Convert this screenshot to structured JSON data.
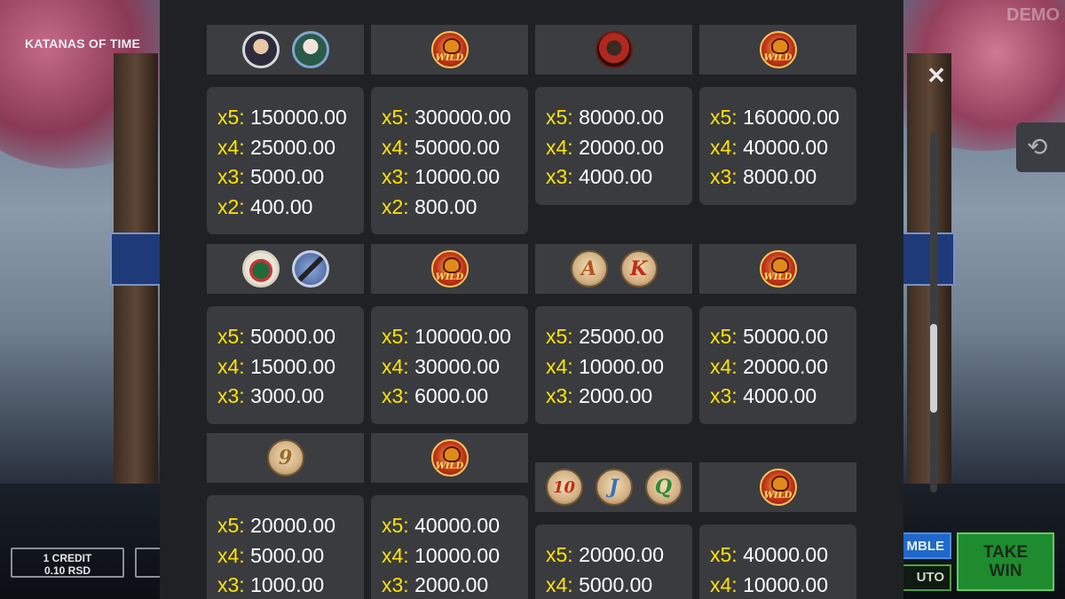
{
  "game": {
    "title": "KATANAS OF TIME",
    "demo_label": "DEMO"
  },
  "bottom_bar": {
    "credit_line1": "1 CREDIT",
    "credit_line2": "0.10 RSD",
    "gamble_label": "MBLE",
    "auto_label": "UTO",
    "take_win_line1": "TAKE",
    "take_win_line2": "WIN"
  },
  "controls": {
    "close_icon": "close-icon",
    "history_icon": "history-icon"
  },
  "paytable": [
    {
      "symbols": [
        "samurai-portrait",
        "geisha-portrait"
      ],
      "pays": [
        [
          "x5:",
          "150000.00"
        ],
        [
          "x4:",
          "25000.00"
        ],
        [
          "x3:",
          "5000.00"
        ],
        [
          "x2:",
          "400.00"
        ]
      ]
    },
    {
      "symbols": [
        "wild"
      ],
      "pays": [
        [
          "x5:",
          "300000.00"
        ],
        [
          "x4:",
          "50000.00"
        ],
        [
          "x3:",
          "10000.00"
        ],
        [
          "x2:",
          "800.00"
        ]
      ]
    },
    {
      "symbols": [
        "samurai-mask"
      ],
      "pays": [
        [
          "x5:",
          "80000.00"
        ],
        [
          "x4:",
          "20000.00"
        ],
        [
          "x3:",
          "4000.00"
        ]
      ]
    },
    {
      "symbols": [
        "wild"
      ],
      "pays": [
        [
          "x5:",
          "160000.00"
        ],
        [
          "x4:",
          "40000.00"
        ],
        [
          "x3:",
          "8000.00"
        ]
      ]
    },
    {
      "symbols": [
        "fan",
        "katana"
      ],
      "pays": [
        [
          "x5:",
          "50000.00"
        ],
        [
          "x4:",
          "15000.00"
        ],
        [
          "x3:",
          "3000.00"
        ]
      ]
    },
    {
      "symbols": [
        "wild"
      ],
      "pays": [
        [
          "x5:",
          "100000.00"
        ],
        [
          "x4:",
          "30000.00"
        ],
        [
          "x3:",
          "6000.00"
        ]
      ]
    },
    {
      "symbols": [
        "A",
        "K"
      ],
      "pays": [
        [
          "x5:",
          "25000.00"
        ],
        [
          "x4:",
          "10000.00"
        ],
        [
          "x3:",
          "2000.00"
        ]
      ]
    },
    {
      "symbols": [
        "wild"
      ],
      "pays": [
        [
          "x5:",
          "50000.00"
        ],
        [
          "x4:",
          "20000.00"
        ],
        [
          "x3:",
          "4000.00"
        ]
      ]
    },
    {
      "symbols": [
        "9"
      ],
      "pays": [
        [
          "x5:",
          "20000.00"
        ],
        [
          "x4:",
          "5000.00"
        ],
        [
          "x3:",
          "1000.00"
        ]
      ]
    },
    {
      "symbols": [
        "wild"
      ],
      "pays": [
        [
          "x5:",
          "40000.00"
        ],
        [
          "x4:",
          "10000.00"
        ],
        [
          "x3:",
          "2000.00"
        ]
      ]
    },
    {
      "symbols": [
        "10",
        "J",
        "Q"
      ],
      "pays": [
        [
          "x5:",
          "20000.00"
        ],
        [
          "x4:",
          "5000.00"
        ]
      ]
    },
    {
      "symbols": [
        "wild"
      ],
      "pays": [
        [
          "x5:",
          "40000.00"
        ],
        [
          "x4:",
          "10000.00"
        ]
      ]
    }
  ],
  "symbol_text": {
    "wild": "WILD"
  }
}
